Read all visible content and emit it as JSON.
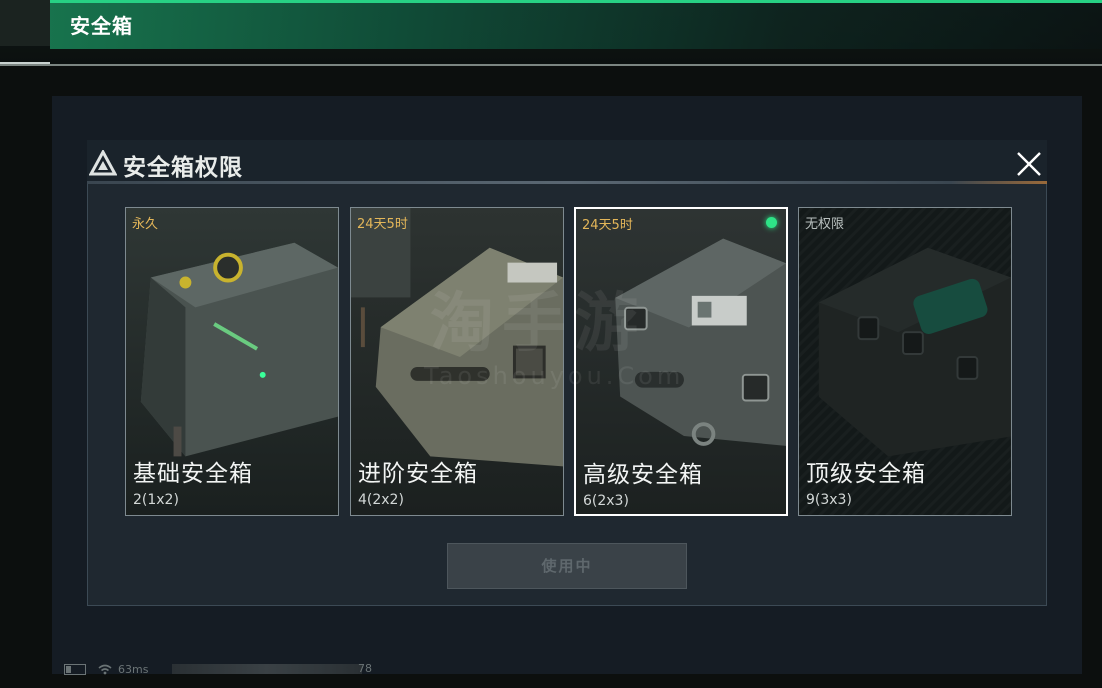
{
  "header": {
    "title": "安全箱"
  },
  "dialog": {
    "title": "安全箱权限",
    "close_icon": "close-icon",
    "cards": [
      {
        "badge": "永久",
        "name": "基础安全箱",
        "size": "2(1x2)",
        "selected": false,
        "active": false
      },
      {
        "badge": "24天5时",
        "name": "进阶安全箱",
        "size": "4(2x2)",
        "selected": false,
        "active": false
      },
      {
        "badge": "24天5时",
        "name": "高级安全箱",
        "size": "6(2x3)",
        "selected": true,
        "active": true
      },
      {
        "badge": "无权限",
        "name": "顶级安全箱",
        "size": "9(3x3)",
        "selected": false,
        "active": false
      }
    ],
    "use_button": "使用中"
  },
  "watermark": {
    "main": "淘手游",
    "sub": "Taoshouyou.Com"
  },
  "status_bar": {
    "ping": "63ms",
    "number": "78"
  },
  "colors": {
    "accent_green": "#27d184",
    "badge_gold": "#e3b659",
    "active_dot": "#2ee387"
  }
}
